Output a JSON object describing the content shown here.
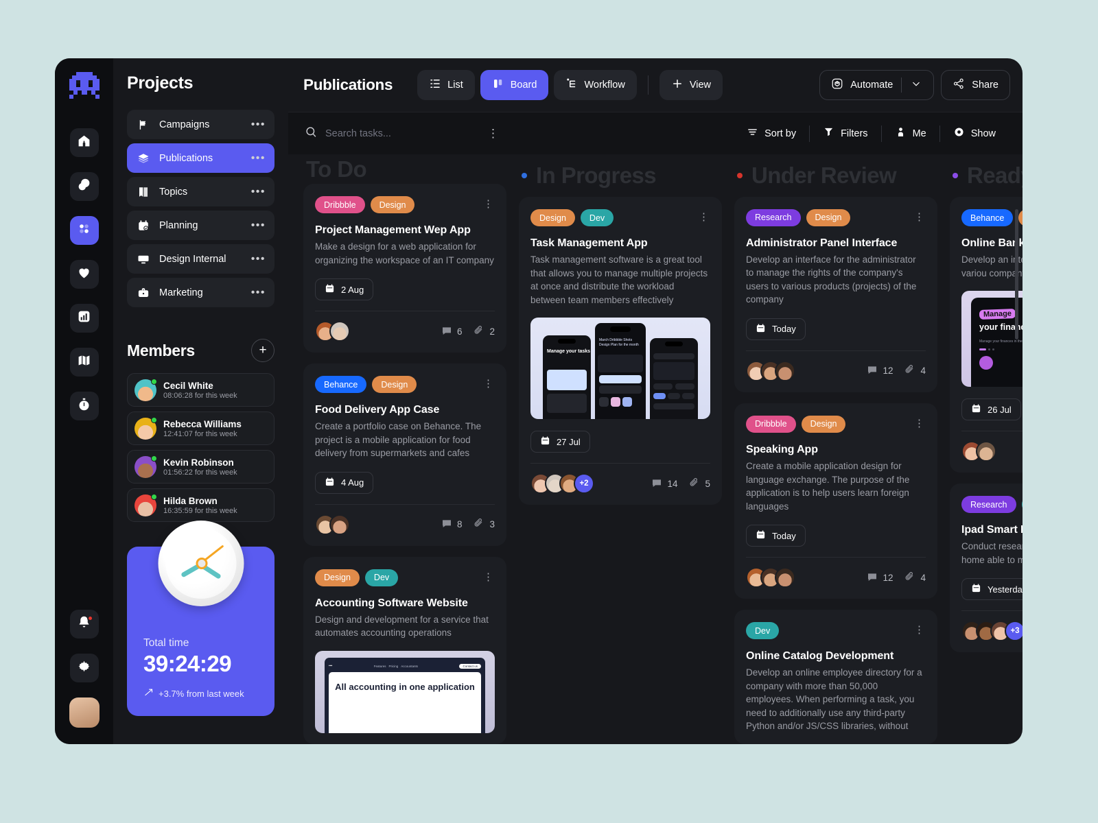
{
  "rail": {
    "logo": "space-invader-logo",
    "items": [
      {
        "name": "home",
        "icon": "home-icon",
        "active": false
      },
      {
        "name": "messages",
        "icon": "chat-icon",
        "active": false
      },
      {
        "name": "projects",
        "icon": "grid-icon",
        "active": true
      },
      {
        "name": "favorites",
        "icon": "heart-icon",
        "active": false
      },
      {
        "name": "analytics",
        "icon": "chart-icon",
        "active": false
      },
      {
        "name": "map",
        "icon": "map-icon",
        "active": false
      },
      {
        "name": "timer",
        "icon": "stopwatch-icon",
        "active": false
      }
    ],
    "bottom": [
      {
        "name": "notifications",
        "icon": "bell-icon",
        "badge": true
      },
      {
        "name": "settings",
        "icon": "gear-icon",
        "badge": false
      }
    ],
    "avatar": "user-avatar"
  },
  "sidebar": {
    "title": "Projects",
    "projects": [
      {
        "label": "Campaigns",
        "icon": "flag-icon",
        "active": false
      },
      {
        "label": "Publications",
        "icon": "layers-icon",
        "active": true
      },
      {
        "label": "Topics",
        "icon": "book-icon",
        "active": false
      },
      {
        "label": "Planning",
        "icon": "calendar-check-icon",
        "active": false
      },
      {
        "label": "Design Internal",
        "icon": "monitor-icon",
        "active": false
      },
      {
        "label": "Marketing",
        "icon": "briefcase-icon",
        "active": false
      }
    ],
    "members_title": "Members",
    "add_member_label": "+",
    "members": [
      {
        "name": "Cecil White",
        "time": "08:06:28 for this week",
        "status": "online",
        "c1": "#4fc3c7",
        "c2": "#f0b98a"
      },
      {
        "name": "Rebecca Williams",
        "time": "12:41:07 for this week",
        "status": "online",
        "c1": "#e8b118",
        "c2": "#f4c9a8"
      },
      {
        "name": "Kevin Robinson",
        "time": "01:56:22 for this week",
        "status": "online",
        "c1": "#8a4fc7",
        "c2": "#a9704e"
      },
      {
        "name": "Hilda Brown",
        "time": "16:35:59 for this week",
        "status": "online",
        "c1": "#e8453c",
        "c2": "#e8c0a5"
      }
    ],
    "timer": {
      "label": "Total time",
      "value": "39:24:29",
      "delta": "+3.7% from last week",
      "accent": "#5a5bf0"
    }
  },
  "topbar": {
    "title": "Publications",
    "views": [
      {
        "label": "List",
        "icon": "list-icon",
        "active": false
      },
      {
        "label": "Board",
        "icon": "board-icon",
        "active": true
      },
      {
        "label": "Workflow",
        "icon": "workflow-icon",
        "active": false
      }
    ],
    "add_view_label": "View",
    "automate_label": "Automate",
    "share_label": "Share"
  },
  "filterbar": {
    "search_placeholder": "Search tasks...",
    "search_value": "",
    "actions": [
      {
        "label": "Sort by",
        "icon": "sort-icon"
      },
      {
        "label": "Filters",
        "icon": "filter-icon"
      },
      {
        "label": "Me",
        "icon": "person-icon"
      },
      {
        "label": "Show",
        "icon": "eye-icon"
      }
    ]
  },
  "board": {
    "columns": [
      {
        "title": "To Do",
        "dot": null,
        "cards": [
          {
            "tags": [
              {
                "label": "Dribbble",
                "color": "#e0518a"
              },
              {
                "label": "Design",
                "color": "#e08b4a"
              }
            ],
            "title": "Project Management Wep App",
            "desc": "Make a design for a web application for organizing the workspace of an IT company",
            "date": "2 Aug",
            "thumb": null,
            "avatars": [
              "#d79b6e",
              "#cfa88a"
            ],
            "extra": null,
            "comments": "6",
            "attachments": "2"
          },
          {
            "tags": [
              {
                "label": "Behance",
                "color": "#1769ff"
              },
              {
                "label": "Design",
                "color": "#e08b4a"
              }
            ],
            "title": "Food Delivery App Case",
            "desc": "Create a portfolio case on Behance. The project is a mobile application for food delivery from supermarkets and cafes",
            "date": "4 Aug",
            "thumb": null,
            "avatars": [
              "#e3c0a2",
              "#c99a7a"
            ],
            "extra": null,
            "comments": "8",
            "attachments": "3"
          },
          {
            "tags": [
              {
                "label": "Design",
                "color": "#e08b4a"
              },
              {
                "label": "Dev",
                "color": "#2aa6a6"
              }
            ],
            "title": "Accounting Software Website",
            "desc": "Design and development for a service that automates accounting operations",
            "date": null,
            "thumb": "tablet-accounting",
            "thumb_text": "All accounting in one application",
            "thumb_nav": [
              "Features",
              "Pricing",
              "Accountants"
            ],
            "thumb_cta": "Contact us",
            "avatars": [],
            "extra": null,
            "comments": null,
            "attachments": null
          }
        ]
      },
      {
        "title": "In Progress",
        "dot": "#2f6fe0",
        "cards": [
          {
            "tags": [
              {
                "label": "Design",
                "color": "#e08b4a"
              },
              {
                "label": "Dev",
                "color": "#2aa6a6"
              }
            ],
            "title": "Task Management App",
            "desc": "Task management software is a great tool that allows you to manage multiple projects at once and distribute the workload between team members effectively",
            "date": "27 Jul",
            "thumb": "phones-tasks",
            "thumb_text": "Manage your tasks",
            "thumb_sub": "March Dribbble Shots Design Plan for the month",
            "avatars": [
              "#e0b49c",
              "#d9d2cc",
              "#c79a72"
            ],
            "extra": "+2",
            "comments": "14",
            "attachments": "5"
          }
        ]
      },
      {
        "title": "Under Review",
        "dot": "#d6342c",
        "cards": [
          {
            "tags": [
              {
                "label": "Research",
                "color": "#7d3ce0"
              },
              {
                "label": "Design",
                "color": "#e08b4a"
              }
            ],
            "title": "Administrator Panel Interface",
            "desc": "Develop an interface for the administrator to manage the rights of the company's users to various products (projects) of the company",
            "date": "Today",
            "thumb": null,
            "avatars": [
              "#e8c6ae",
              "#c59474",
              "#b5805e"
            ],
            "extra": null,
            "comments": "12",
            "attachments": "4"
          },
          {
            "tags": [
              {
                "label": "Dribbble",
                "color": "#e0518a"
              },
              {
                "label": "Design",
                "color": "#e08b4a"
              }
            ],
            "title": "Speaking App",
            "desc": "Create a mobile application design for language exchange. The purpose of the application is to help users learn foreign languages",
            "date": "Today",
            "thumb": null,
            "avatars": [
              "#dcb79a",
              "#c59474",
              "#b5805e"
            ],
            "extra": null,
            "comments": "12",
            "attachments": "4"
          },
          {
            "tags": [
              {
                "label": "Dev",
                "color": "#2aa6a6"
              }
            ],
            "title": "Online Catalog Development",
            "desc": "Develop an online employee directory for a company with more than 50,000 employees. When performing a task, you need to additionally use any third-party Python and/or JS/CSS libraries, without",
            "date": null,
            "thumb": null,
            "avatars": [],
            "extra": null,
            "comments": null,
            "attachments": null
          }
        ]
      },
      {
        "title": "Ready",
        "dot": "#8b4ce8",
        "cards": [
          {
            "tags": [
              {
                "label": "Behance",
                "color": "#1769ff"
              },
              {
                "label": "De",
                "color": "#e08b4a"
              }
            ],
            "title": "Online Bank A",
            "desc": "Develop an inte to manage the users to variou company",
            "date": "26 Jul",
            "thumb": "bank-phone",
            "thumb_badge": "Manage",
            "thumb_text": "your finances wisely",
            "avatars": [
              "#e0a890",
              "#cba98c"
            ],
            "extra": null,
            "comments": null,
            "attachments": null
          },
          {
            "tags": [
              {
                "label": "Research",
                "color": "#7d3ce0"
              },
              {
                "label": "D",
                "color": "#2aa6a6"
              }
            ],
            "title": "Ipad Smart H",
            "desc": "Conduct resear application inte is a smart home able to manage",
            "date": "Yesterday",
            "thumb": null,
            "avatars": [
              "#c59474",
              "#9c6b4a",
              "#e3b79c"
            ],
            "extra": "+3",
            "comments": null,
            "attachments": null
          }
        ]
      }
    ]
  }
}
